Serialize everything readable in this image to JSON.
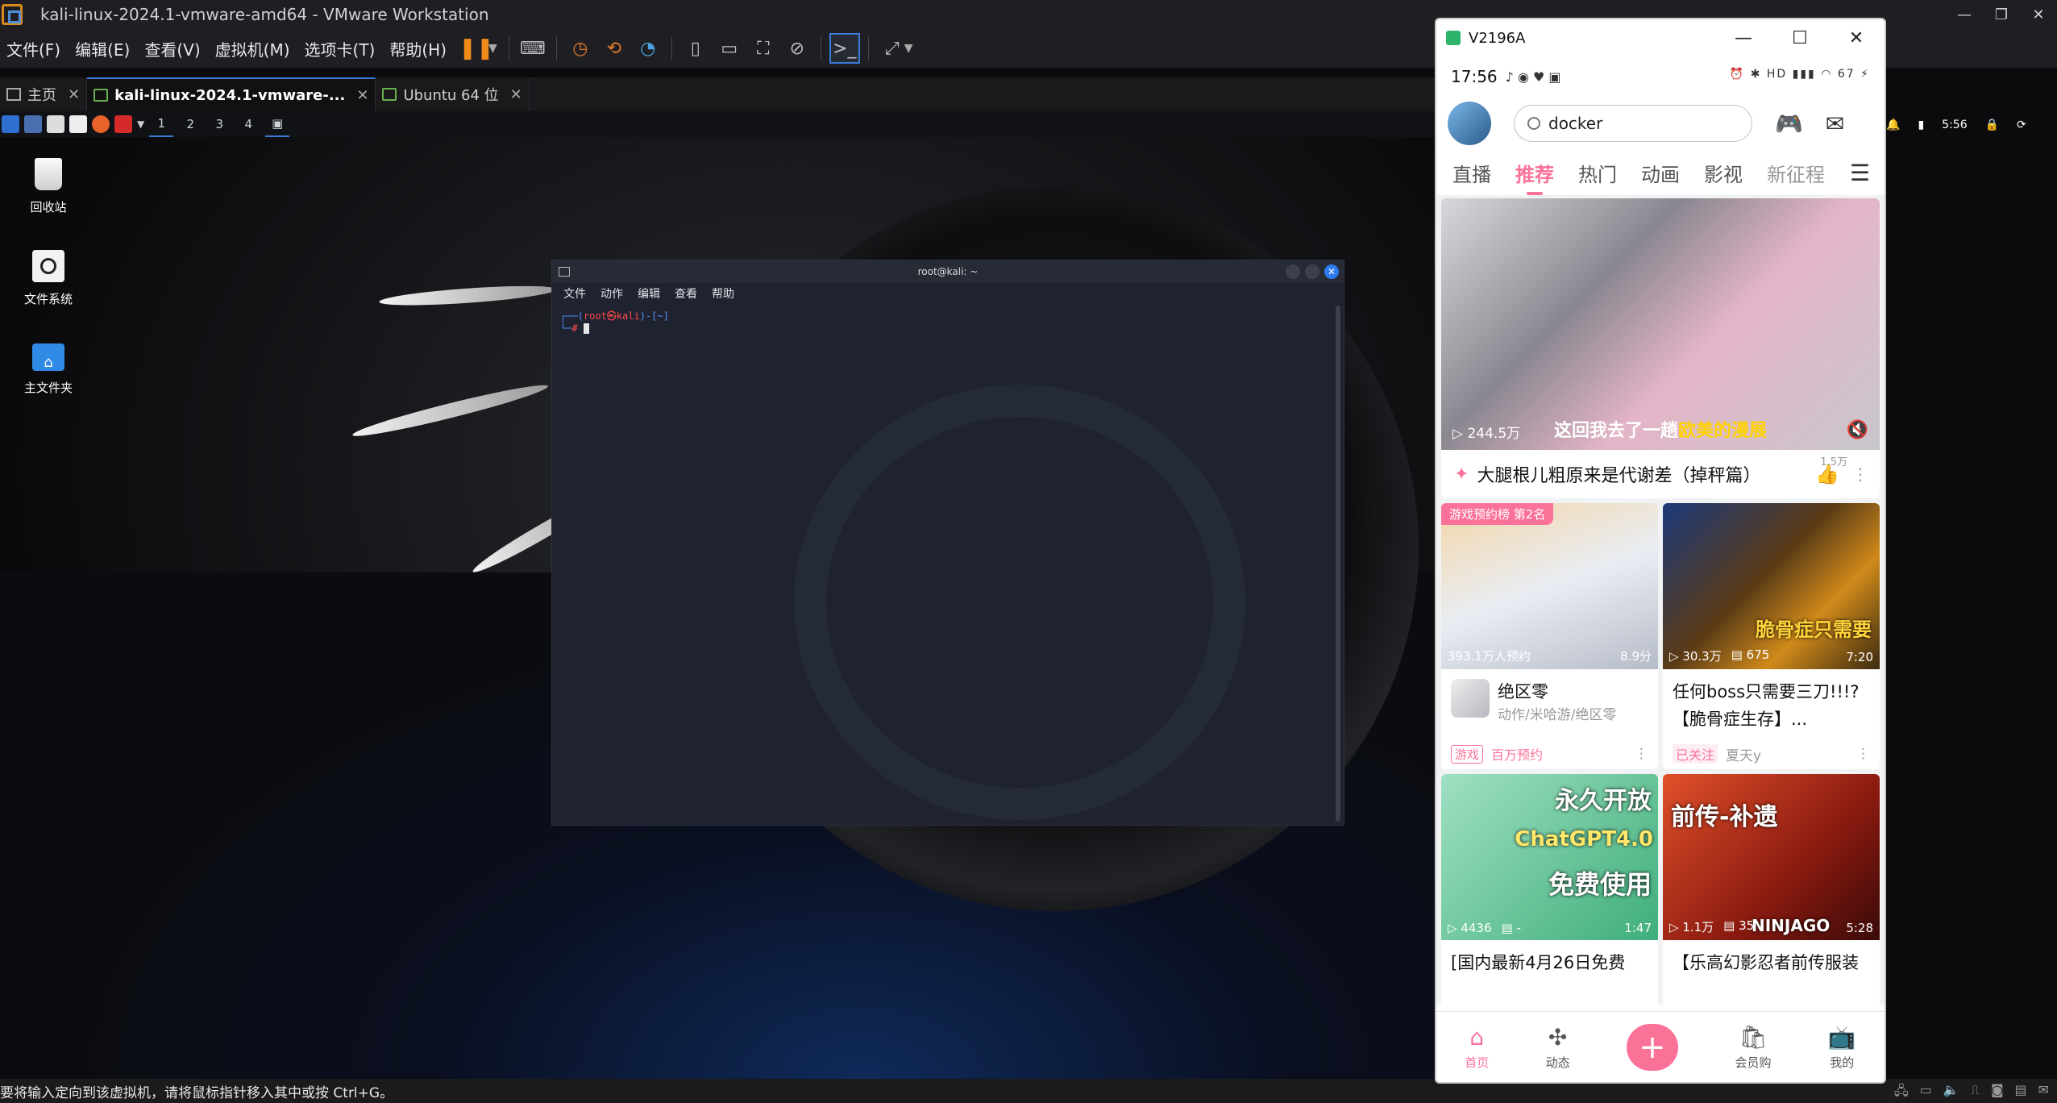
{
  "vmware": {
    "title": "kali-linux-2024.1-vmware-amd64 - VMware Workstation",
    "menus": [
      "文件(F)",
      "编辑(E)",
      "查看(V)",
      "虚拟机(M)",
      "选项卡(T)",
      "帮助(H)"
    ],
    "tabs": [
      {
        "label": "主页"
      },
      {
        "label": "kali-linux-2024.1-vmware-..."
      },
      {
        "label": "Ubuntu 64 位"
      }
    ],
    "status_text": "要将输入定向到该虚拟机，请将鼠标指针移入其中或按 Ctrl+G。"
  },
  "kali": {
    "workspaces": [
      "1",
      "2",
      "3",
      "4"
    ],
    "clock": "5:56",
    "desktop_icons": [
      "回收站",
      "文件系统",
      "主文件夹"
    ]
  },
  "terminal": {
    "title": "root@kali: ~",
    "menus": [
      "文件",
      "动作",
      "编辑",
      "查看",
      "帮助"
    ],
    "prompt_user": "root㉿kali",
    "prompt_path": "[~]"
  },
  "phone": {
    "window_title": "V2196A",
    "time": "17:56",
    "battery": "67",
    "search_text": "docker",
    "tabs": [
      "直播",
      "推荐",
      "热门",
      "动画",
      "影视",
      "新征程"
    ],
    "big_card": {
      "views": "244.5万",
      "subtitle_pre": "这回我去了一趟",
      "subtitle_hl": "欧美的漫展",
      "title": "大腿根儿粗原来是代谢差（掉秤篇）",
      "likes": "1.5万"
    },
    "cards": [
      {
        "badge": "游戏预约榜 第2名",
        "stat1": "393.1万人预约",
        "stat2": "8.9分",
        "name": "绝区零",
        "sub": "动作/米哈游/绝区零",
        "tag": "游戏",
        "tag2": "百万预约"
      },
      {
        "stat1": "30.3万",
        "stat2": "675",
        "dur": "7:20",
        "cover_text": "脆骨症只需要",
        "title": "任何boss只需要三刀!!!?【脆骨症生存】...",
        "tag": "已关注",
        "author": "夏天y"
      },
      {
        "stat1": "4436",
        "stat2": "-",
        "dur": "1:47",
        "cover_text1": "永久开放",
        "cover_text2": "ChatGPT4.0",
        "cover_text3": "免费使用",
        "title": "[国内最新4月26日免费"
      },
      {
        "stat1": "1.1万",
        "stat2": "35",
        "dur": "5:28",
        "cover_text": "前传-补遗",
        "cover_brand": "NINJAGO",
        "title": "【乐高幻影忍者前传服装"
      }
    ],
    "bottom_nav": [
      "首页",
      "动态",
      "",
      "会员购",
      "我的"
    ]
  }
}
